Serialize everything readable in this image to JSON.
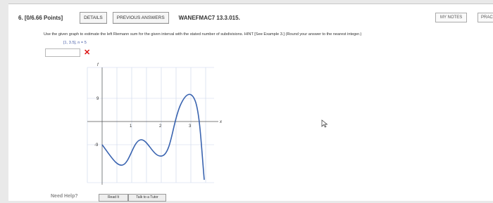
{
  "question": {
    "title": "6. [0/6.66 Points]",
    "buttons": {
      "details": "DETAILS",
      "previous_answers": "PREVIOUS ANSWERS"
    },
    "code": "WANEFMAC7 13.3.015.",
    "my_notes": "MY NOTES",
    "practice": "PRAC"
  },
  "instructions": "Use the given graph to estimate the left Riemann sum for the given interval with the stated number of subdivisions. HINT [See Example 3.] (Round your answer to the nearest integer.)",
  "interval": "[1, 3.5], n = 5",
  "answer": {
    "value": "",
    "status": "incorrect",
    "status_icon": "x-mark-icon"
  },
  "graph": {
    "y_label": "f",
    "x_label": "x",
    "x_ticks": [
      "1",
      "2",
      "3"
    ],
    "y_ticks": [
      "9",
      "-9"
    ]
  },
  "help": {
    "label": "Need Help?",
    "read_it": "Read It",
    "talk_to_tutor": "Talk to a Tutor"
  },
  "colors": {
    "incorrect": "#dd1111",
    "curve": "#3a64b0",
    "grid": "#c9d6ea"
  }
}
